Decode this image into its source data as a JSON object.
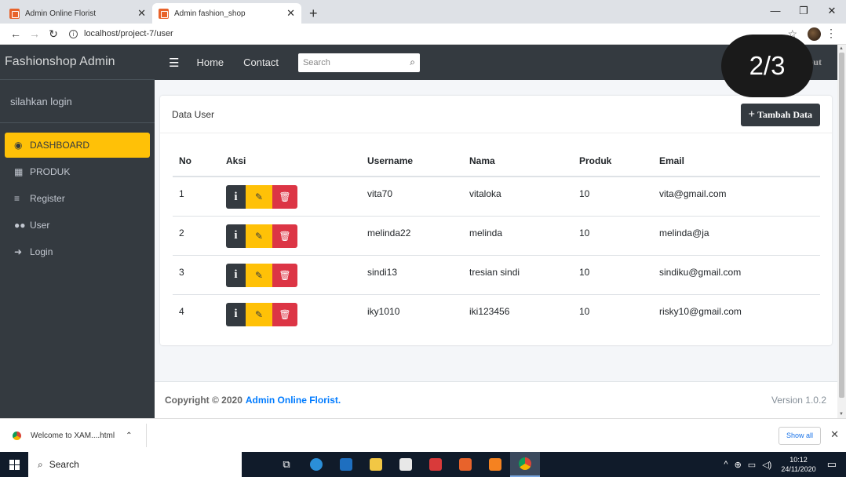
{
  "browser": {
    "tabs": [
      {
        "title": "Admin Online Florist",
        "active": false
      },
      {
        "title": "Admin fashion_shop",
        "active": true
      }
    ],
    "url": "localhost/project-7/user"
  },
  "counter": "2/3",
  "sidebar": {
    "brand": "Fashionshop Admin",
    "user_panel": "silahkan login",
    "items": [
      {
        "label": "DASHBOARD",
        "icon": "dashboard-icon",
        "active": true
      },
      {
        "label": "PRODUK",
        "icon": "building-icon",
        "active": false
      },
      {
        "label": "Register",
        "icon": "list-icon",
        "active": false
      },
      {
        "label": "User",
        "icon": "users-icon",
        "active": false
      },
      {
        "label": "Login",
        "icon": "sign-in-icon",
        "active": false
      }
    ]
  },
  "navbar": {
    "links": [
      "Home",
      "Contact"
    ],
    "search_placeholder": "Search",
    "logout": "Logout"
  },
  "card": {
    "title": "Data User",
    "add_button": "Tambah Data"
  },
  "table": {
    "columns": [
      "No",
      "Aksi",
      "Username",
      "Nama",
      "Produk",
      "Email"
    ],
    "rows": [
      {
        "no": "1",
        "username": "vita70",
        "nama": "vitaloka",
        "produk": "10",
        "email": "vita@gmail.com"
      },
      {
        "no": "2",
        "username": "melinda22",
        "nama": "melinda",
        "produk": "10",
        "email": "melinda@ja"
      },
      {
        "no": "3",
        "username": "sindi13",
        "nama": "tresian sindi",
        "produk": "10",
        "email": "sindiku@gmail.com"
      },
      {
        "no": "4",
        "username": "iky1010",
        "nama": "iki123456",
        "produk": "10",
        "email": "risky10@gmail.com"
      }
    ]
  },
  "footer": {
    "copyright": "Copyright © 2020",
    "org": "Admin Online Florist.",
    "version": "Version 1.0.2"
  },
  "download_bar": {
    "file": "Welcome to XAM....html",
    "show_all": "Show all"
  },
  "taskbar": {
    "search": "Search",
    "time": "10:12",
    "date": "24/11/2020"
  },
  "colors": {
    "sidebar": "#343a40",
    "accent": "#ffc107",
    "danger": "#dc3545",
    "link": "#007bff"
  }
}
